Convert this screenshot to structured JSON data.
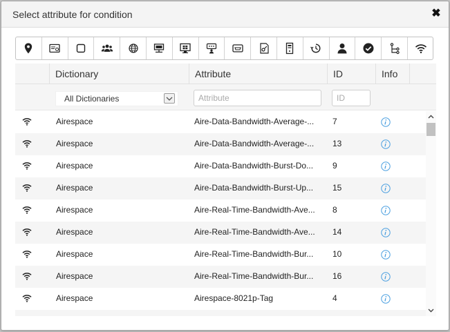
{
  "dialog": {
    "title": "Select attribute for condition",
    "close_glyph": "✖"
  },
  "toolbar": {
    "icons": [
      "location-pin-icon",
      "id-card-icon",
      "checkbox-icon",
      "user-group-icon",
      "globe-icon",
      "network-device-icon",
      "windows-monitor-icon",
      "guest-badge-icon",
      "router-icon",
      "certificate-icon",
      "server-icon",
      "clock-icon",
      "user-icon",
      "check-circle-icon",
      "network-tree-icon",
      "wifi-icon"
    ]
  },
  "columns": {
    "dictionary": "Dictionary",
    "attribute": "Attribute",
    "id": "ID",
    "info": "Info"
  },
  "filters": {
    "dictionary_value": "All Dictionaries",
    "attribute_placeholder": "Attribute",
    "id_placeholder": "ID"
  },
  "rows": [
    {
      "icon": "wifi-icon",
      "dictionary": "Airespace",
      "attribute": "Aire-Data-Bandwidth-Average-...",
      "id": "7"
    },
    {
      "icon": "wifi-icon",
      "dictionary": "Airespace",
      "attribute": "Aire-Data-Bandwidth-Average-...",
      "id": "13"
    },
    {
      "icon": "wifi-icon",
      "dictionary": "Airespace",
      "attribute": "Aire-Data-Bandwidth-Burst-Do...",
      "id": "9"
    },
    {
      "icon": "wifi-icon",
      "dictionary": "Airespace",
      "attribute": "Aire-Data-Bandwidth-Burst-Up...",
      "id": "15"
    },
    {
      "icon": "wifi-icon",
      "dictionary": "Airespace",
      "attribute": "Aire-Real-Time-Bandwidth-Ave...",
      "id": "8"
    },
    {
      "icon": "wifi-icon",
      "dictionary": "Airespace",
      "attribute": "Aire-Real-Time-Bandwidth-Ave...",
      "id": "14"
    },
    {
      "icon": "wifi-icon",
      "dictionary": "Airespace",
      "attribute": "Aire-Real-Time-Bandwidth-Bur...",
      "id": "10"
    },
    {
      "icon": "wifi-icon",
      "dictionary": "Airespace",
      "attribute": "Aire-Real-Time-Bandwidth-Bur...",
      "id": "16"
    },
    {
      "icon": "wifi-icon",
      "dictionary": "Airespace",
      "attribute": "Airespace-8021p-Tag",
      "id": "4"
    },
    {
      "icon": "wifi-icon",
      "dictionary": "",
      "attribute": "",
      "id": ""
    }
  ],
  "colors": {
    "info_icon": "#4a9fe0",
    "header_bg": "#f5f5f5",
    "row_alt_bg": "#f5f5f5"
  }
}
